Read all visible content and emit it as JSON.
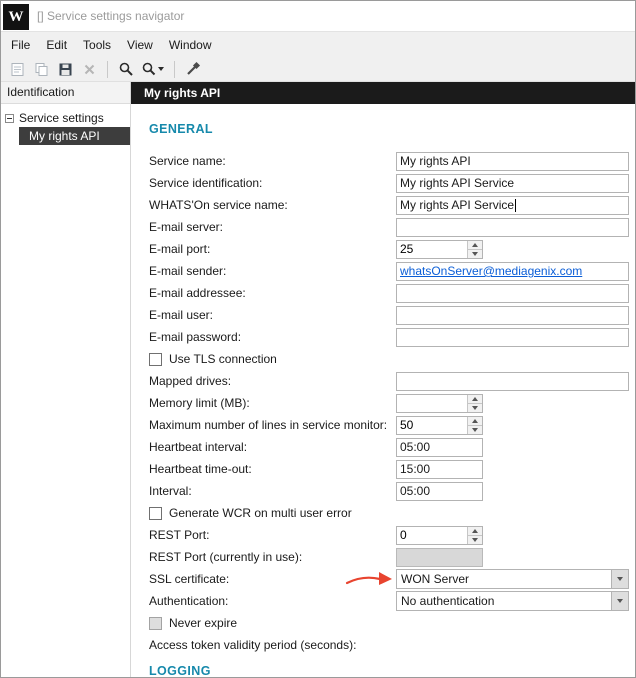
{
  "window": {
    "logo": "W",
    "title": "[] Service settings navigator"
  },
  "menu": {
    "items": [
      "File",
      "Edit",
      "Tools",
      "View",
      "Window"
    ]
  },
  "toolbar": {
    "icons": [
      "report-icon",
      "copy-icon",
      "save-icon",
      "delete-icon",
      "search-icon",
      "search-options-icon",
      "tools-icon"
    ]
  },
  "sidebar": {
    "header": "Identification",
    "tree": {
      "root": "Service settings",
      "selected_child": "My rights API"
    }
  },
  "main": {
    "header": "My rights API",
    "sections": {
      "general": "GENERAL",
      "logging": "LOGGING"
    }
  },
  "fields": {
    "service_name": {
      "label": "Service name:",
      "value": "My rights API"
    },
    "service_identification": {
      "label": "Service identification:",
      "value": "My rights API Service"
    },
    "whatson_service_name": {
      "label": "WHATS'On service name:",
      "value": "My rights API Service"
    },
    "email_server": {
      "label": "E-mail server:",
      "value": ""
    },
    "email_port": {
      "label": "E-mail port:",
      "value": "25"
    },
    "email_sender": {
      "label": "E-mail sender:",
      "value": "whatsOnServer@mediagenix.com"
    },
    "email_addressee": {
      "label": "E-mail addressee:",
      "value": ""
    },
    "email_user": {
      "label": "E-mail user:",
      "value": ""
    },
    "email_password": {
      "label": "E-mail password:",
      "value": ""
    },
    "use_tls": {
      "label": "Use TLS connection",
      "checked": false
    },
    "mapped_drives": {
      "label": "Mapped drives:",
      "value": ""
    },
    "memory_limit": {
      "label": "Memory limit (MB):",
      "value": ""
    },
    "max_lines": {
      "label": "Maximum number of lines in service monitor:",
      "value": "50"
    },
    "heartbeat_interval": {
      "label": "Heartbeat interval:",
      "value": "05:00"
    },
    "heartbeat_timeout": {
      "label": "Heartbeat time-out:",
      "value": "15:00"
    },
    "interval": {
      "label": "Interval:",
      "value": "05:00"
    },
    "generate_wcr": {
      "label": "Generate WCR on multi user error",
      "checked": false
    },
    "rest_port": {
      "label": "REST Port:",
      "value": "0"
    },
    "rest_port_in_use": {
      "label": "REST Port (currently in use):",
      "value": ""
    },
    "ssl_certificate": {
      "label": "SSL certificate:",
      "value": "WON Server"
    },
    "authentication": {
      "label": "Authentication:",
      "value": "No authentication"
    },
    "never_expire": {
      "label": "Never expire",
      "checked": false
    },
    "access_token_validity": {
      "label": "Access token validity period (seconds):"
    }
  },
  "colors": {
    "accent": "#1689ab",
    "link": "#0b5ed7",
    "selection": "#3d3d3d",
    "header_bar": "#1b1b1b",
    "annotation_arrow": "#e8442f"
  }
}
